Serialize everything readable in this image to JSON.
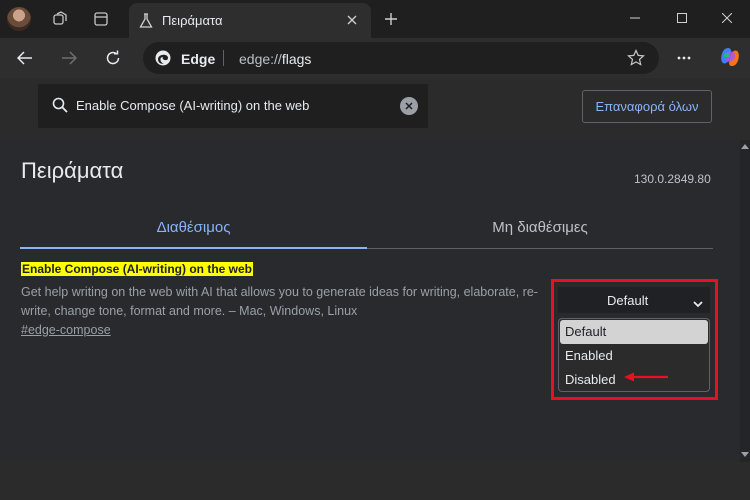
{
  "browser": {
    "tab": {
      "title": "Πειράματα"
    },
    "omnibox": {
      "brand": "Edge",
      "scheme_host": "edge://",
      "path": "flags"
    }
  },
  "page": {
    "search": {
      "value": "Enable Compose (AI-writing) on the web"
    },
    "reset_label": "Επαναφορά όλων",
    "title": "Πειράματα",
    "version": "130.0.2849.80",
    "tabs": {
      "available": "Διαθέσιμος",
      "unavailable": "Μη διαθέσιμες"
    },
    "flag": {
      "name": "Enable Compose (AI-writing) on the web",
      "description": "Get help writing on the web with AI that allows you to generate ideas for writing, elaborate, re-write, change tone, format and more. – Mac, Windows, Linux",
      "link": "#edge-compose",
      "select_value": "Default",
      "options": [
        "Default",
        "Enabled",
        "Disabled"
      ]
    }
  },
  "colors": {
    "accent": "#8ab4f8",
    "highlight": "#ffff00",
    "annotation": "#e81123"
  }
}
